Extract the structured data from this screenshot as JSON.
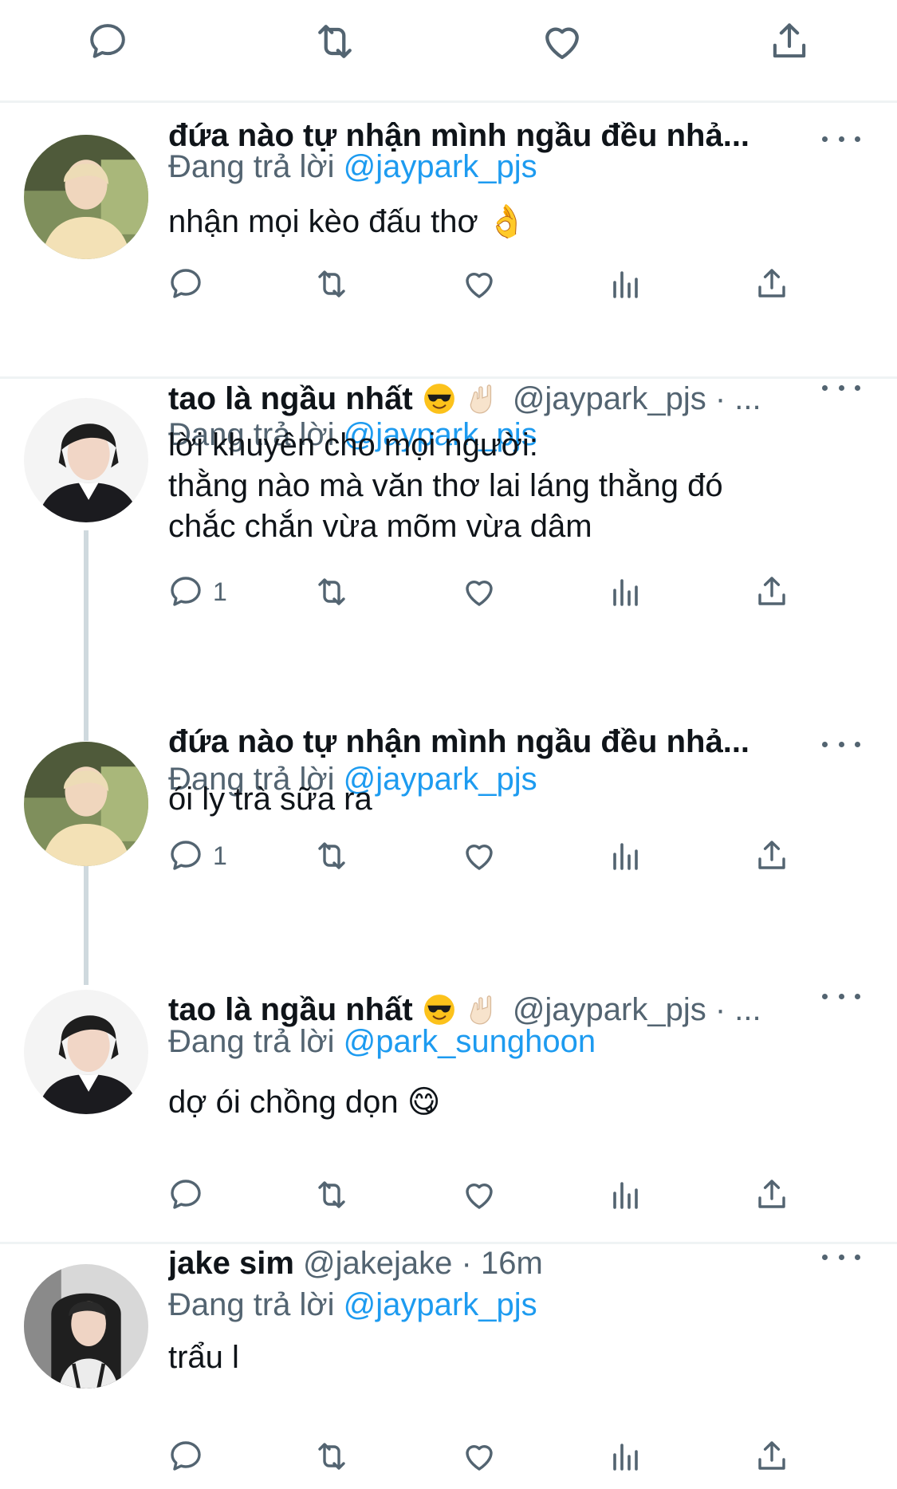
{
  "colors": {
    "accent": "#1d9bf0",
    "muted": "#536471",
    "text": "#0f1419",
    "divider": "#eff3f4"
  },
  "top_actions": [
    {
      "icon": "reply-icon"
    },
    {
      "icon": "retweet-icon"
    },
    {
      "icon": "like-icon"
    },
    {
      "icon": "share-icon"
    }
  ],
  "tweets": [
    {
      "display_name": "đứa nào tự nhận mình ngầu đều nhả...",
      "handle": "",
      "meta": "",
      "reply_prefix": "Đang trả lời",
      "reply_to": "@jaypark_pjs",
      "text": "nhận mọi kèo đấu thơ 👌",
      "reply_count": "",
      "avatar": "avatar-blond"
    },
    {
      "display_name": "tao là ngầu nhất",
      "handle": "@jaypark_pjs",
      "meta": "· ...",
      "reply_prefix": "Đang trả lời",
      "reply_to": "@jaypark_pjs",
      "text": "lời khuyên cho mọi người:\nthằng nào mà văn thơ lai láng thằng đó\nchắc chắn vừa mõm vừa dâm",
      "reply_count": "1",
      "avatar": "avatar-dark"
    },
    {
      "display_name": "đứa nào tự nhận mình ngầu đều nhả...",
      "handle": "",
      "meta": "",
      "reply_prefix": "Đang trả lời",
      "reply_to": "@jaypark_pjs",
      "text": "ói ly trà sữa ra",
      "reply_count": "1",
      "avatar": "avatar-blond"
    },
    {
      "display_name": "tao là ngầu nhất",
      "handle": "@jaypark_pjs",
      "meta": "· ...",
      "reply_prefix": "Đang trả lời",
      "reply_to": "@park_sunghoon",
      "text": "dợ ói chồng dọn 😋",
      "reply_count": "",
      "avatar": "avatar-dark"
    },
    {
      "display_name": "jake sim",
      "handle": "@jakejake",
      "meta": "· 16m",
      "reply_prefix": "Đang trả lời",
      "reply_to": "@jaypark_pjs",
      "text": "trẩu l",
      "reply_count": "",
      "avatar": "avatar-hood"
    }
  ]
}
